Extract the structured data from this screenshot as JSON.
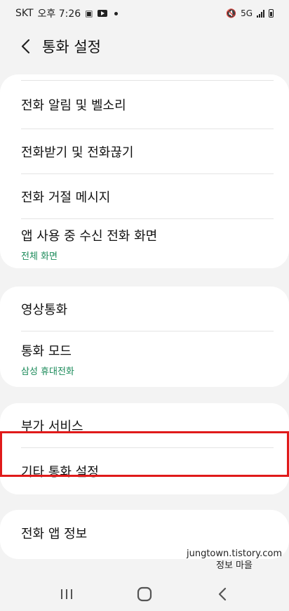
{
  "status_bar": {
    "carrier": "SKT",
    "time": "오후 7:26",
    "network": "5G"
  },
  "header": {
    "back_icon": "chevron-left-icon",
    "title": "통화 설정"
  },
  "groups": [
    {
      "items": [
        {
          "label": "전화 알림 및 벨소리"
        },
        {
          "label": "전화받기 및 전화끊기"
        },
        {
          "label": "전화 거절 메시지"
        },
        {
          "label": "앱 사용 중 수신 전화 화면",
          "sub": "전체 화면"
        }
      ]
    },
    {
      "items": [
        {
          "label": "영상통화"
        },
        {
          "label": "통화 모드",
          "sub": "삼성 휴대전화"
        }
      ]
    },
    {
      "items": [
        {
          "label": "부가 서비스"
        },
        {
          "label": "기타 통화 설정"
        }
      ]
    },
    {
      "items": [
        {
          "label": "전화 앱 정보"
        }
      ]
    }
  ],
  "watermark": {
    "line1": "jungtown.tistory.com",
    "line2": "정보 마을"
  },
  "colors": {
    "accent_sub": "#1a8a59",
    "highlight": "#e01a1a",
    "background": "#f3f3f3"
  }
}
